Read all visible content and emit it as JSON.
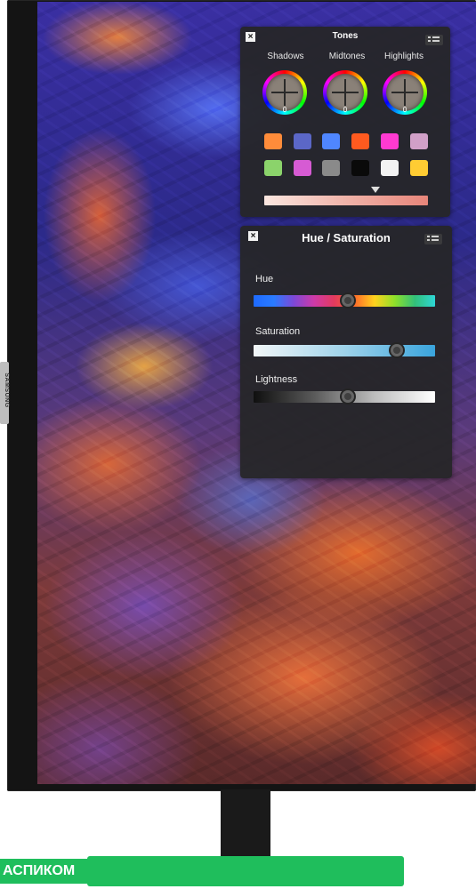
{
  "device": {
    "brand": "SAMSUNG",
    "watermark": "АСПИКОМ"
  },
  "colors": {
    "panel_bg": "#262628",
    "stand_base": "#1fbe5c"
  },
  "tones_panel": {
    "title": "Tones",
    "close_icon": "close-icon",
    "menu_icon": "menu-icon",
    "dials": [
      {
        "label": "Shadows",
        "value": "0"
      },
      {
        "label": "Midtones",
        "value": "0"
      },
      {
        "label": "Highlights",
        "value": "0"
      }
    ],
    "swatches": [
      "#ff8c3a",
      "#5b67c7",
      "#4f86ff",
      "#ff5a1f",
      "#ff3ad1",
      "#d1a0c8",
      "#8bd36b",
      "#d65bd3",
      "#8a8a8a",
      "#0a0a0a",
      "#f3f3f3",
      "#ffcc33"
    ],
    "tone_slider": {
      "position_fraction": 0.68
    }
  },
  "huesat_panel": {
    "title": "Hue / Saturation",
    "close_icon": "close-icon",
    "menu_icon": "menu-icon",
    "sliders": [
      {
        "label": "Hue",
        "value_fraction": 0.52
      },
      {
        "label": "Saturation",
        "value_fraction": 0.79
      },
      {
        "label": "Lightness",
        "value_fraction": 0.52
      }
    ]
  }
}
